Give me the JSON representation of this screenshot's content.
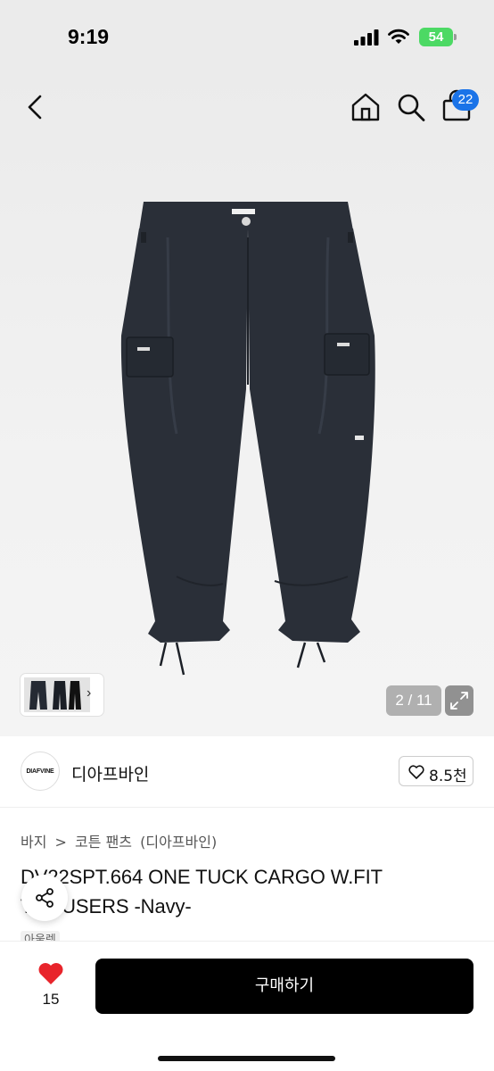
{
  "status": {
    "time": "9:19",
    "battery": "54"
  },
  "header": {
    "cart_badge": "22"
  },
  "gallery": {
    "counter": "2 / 11"
  },
  "seller": {
    "logo_text": "DIAFVINE",
    "name": "디아프바인",
    "likes": "8.5천"
  },
  "breadcrumb": {
    "items": [
      "바지",
      ">",
      "코튼 팬츠",
      "(디아프바인)"
    ]
  },
  "product": {
    "title": "DV22SPT.664 ONE TUCK CARGO W.FIT TROUSERS -Navy-",
    "tag": "아울렛"
  },
  "bottom": {
    "wish_count": "15",
    "buy_label": "구매하기"
  },
  "colors": {
    "accent": "#1a73e8",
    "heart": "#e8242b",
    "battery": "#4cd964",
    "pants": "#2a2f38"
  }
}
